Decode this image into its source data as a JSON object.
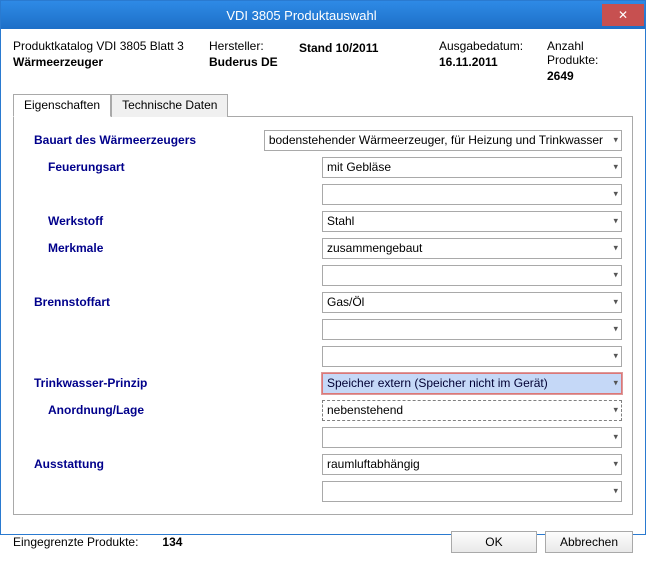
{
  "window": {
    "title": "VDI 3805 Produktauswahl",
    "close_glyph": "✕"
  },
  "header": {
    "catalog_label": "Produktkatalog VDI 3805 Blatt 3",
    "catalog_value": "Wärmeerzeuger",
    "manufacturer_label": "Hersteller:",
    "manufacturer_value": "Buderus DE",
    "edition_label": "",
    "edition_value": "Stand 10/2011",
    "issue_date_label": "Ausgabedatum:",
    "issue_date_value": "16.11.2011",
    "product_count_label": "Anzahl Produkte:",
    "product_count_value": "2649"
  },
  "tabs": {
    "properties": "Eigenschaften",
    "technical": "Technische Daten"
  },
  "rows": [
    {
      "label": "Bauart des Wärmeerzeugers",
      "value": "bodenstehender Wärmeerzeuger, für Heizung und Trinkwasser",
      "indent": false,
      "style": "normal"
    },
    {
      "label": "Feuerungsart",
      "value": "mit Gebläse",
      "indent": true,
      "style": "normal"
    },
    {
      "label": "",
      "value": "",
      "indent": false,
      "style": "normal"
    },
    {
      "label": "Werkstoff",
      "value": "Stahl",
      "indent": true,
      "style": "normal"
    },
    {
      "label": "Merkmale",
      "value": "zusammengebaut",
      "indent": true,
      "style": "normal"
    },
    {
      "label": "",
      "value": "",
      "indent": false,
      "style": "normal"
    },
    {
      "label": "Brennstoffart",
      "value": "Gas/Öl",
      "indent": false,
      "style": "normal"
    },
    {
      "label": "",
      "value": "",
      "indent": false,
      "style": "normal"
    },
    {
      "label": "",
      "value": "",
      "indent": false,
      "style": "normal"
    },
    {
      "label": "Trinkwasser-Prinzip",
      "value": "Speicher extern (Speicher nicht im Gerät)",
      "indent": false,
      "style": "highlighted"
    },
    {
      "label": "Anordnung/Lage",
      "value": "nebenstehend",
      "indent": true,
      "style": "dashed"
    },
    {
      "label": "",
      "value": "",
      "indent": false,
      "style": "normal"
    },
    {
      "label": "Ausstattung",
      "value": "raumluftabhängig",
      "indent": false,
      "style": "normal"
    },
    {
      "label": "",
      "value": "",
      "indent": false,
      "style": "normal"
    }
  ],
  "arrow_glyph": "▾",
  "footer": {
    "status_label": "Eingegrenzte Produkte:",
    "status_value": "134",
    "ok": "OK",
    "cancel": "Abbrechen"
  }
}
